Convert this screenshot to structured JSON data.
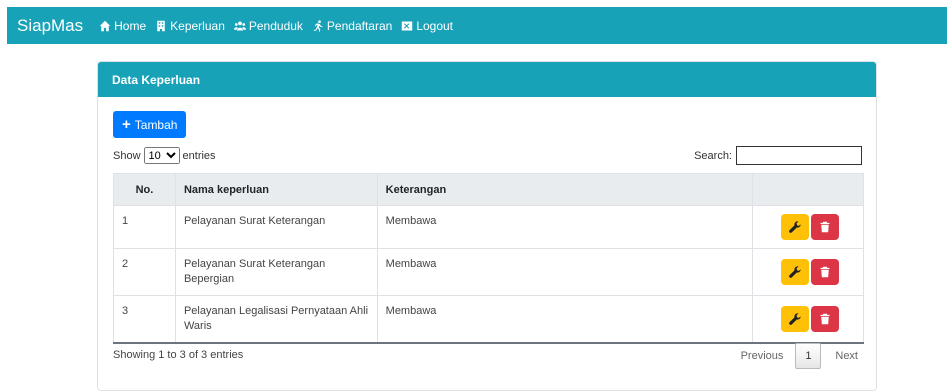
{
  "nav": {
    "brand": "SiapMas",
    "items": [
      {
        "label": "Home",
        "icon": "home-icon"
      },
      {
        "label": "Keperluan",
        "icon": "building-icon"
      },
      {
        "label": "Penduduk",
        "icon": "users-icon"
      },
      {
        "label": "Pendaftaran",
        "icon": "running-icon"
      },
      {
        "label": "Logout",
        "icon": "close-box-icon"
      }
    ]
  },
  "card": {
    "title": "Data Keperluan",
    "add_label": "Tambah",
    "show_prefix": "Show",
    "show_value": "10",
    "show_suffix": "entries",
    "search_label": "Search:",
    "search_value": ""
  },
  "table": {
    "headers": [
      "No.",
      "Nama keperluan",
      "Keterangan",
      ""
    ],
    "rows": [
      {
        "no": "1",
        "nama": "Pelayanan Surat Keterangan",
        "keterangan": "Membawa"
      },
      {
        "no": "2",
        "nama": "Pelayanan Surat Keterangan Bepergian",
        "keterangan": "Membawa"
      },
      {
        "no": "3",
        "nama": "Pelayanan Legalisasi Pernyataan Ahli Waris",
        "keterangan": "Membawa"
      }
    ]
  },
  "footer": {
    "info": "Showing 1 to 3 of 3 entries",
    "previous": "Previous",
    "page": "1",
    "next": "Next"
  },
  "colors": {
    "primary": "#17a2b8",
    "add_button": "#007bff",
    "edit_button": "#ffc107",
    "delete_button": "#dc3545"
  }
}
